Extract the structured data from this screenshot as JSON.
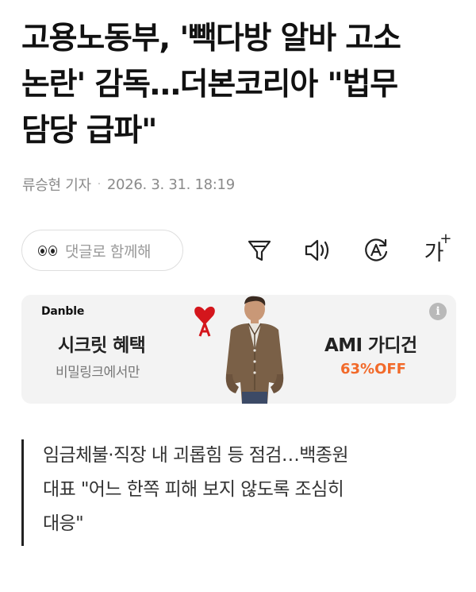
{
  "article": {
    "headline_lines": [
      "고용노동부, '빽다방 알바 고소",
      "논란' 감독…더본코리아 \"법무",
      "담당 급파\""
    ],
    "author": "류승현 기자",
    "separator": "·",
    "timestamp": "2026. 3. 31. 18:19"
  },
  "toolbar": {
    "comment_placeholder": "댓글로 함께해",
    "icons": [
      "eyes-icon",
      "filter-icon",
      "speaker-icon",
      "auto-translate-icon",
      "font-size-icon"
    ],
    "font_size_label": "가",
    "font_size_plus": "+"
  },
  "ad": {
    "brand": "Danble",
    "title": "시크릿 혜택",
    "subtitle": "비밀링크에서만",
    "product": "AMI 가디건",
    "discount": "63%OFF",
    "info_label": "i",
    "accent_color": "#f26a2a"
  },
  "summary": {
    "lines": [
      "임금체불·직장 내 괴롭힘 등 점검…백종원",
      "대표 \"어느 한쪽 피해 보지 않도록 조심히",
      "대응\""
    ]
  }
}
